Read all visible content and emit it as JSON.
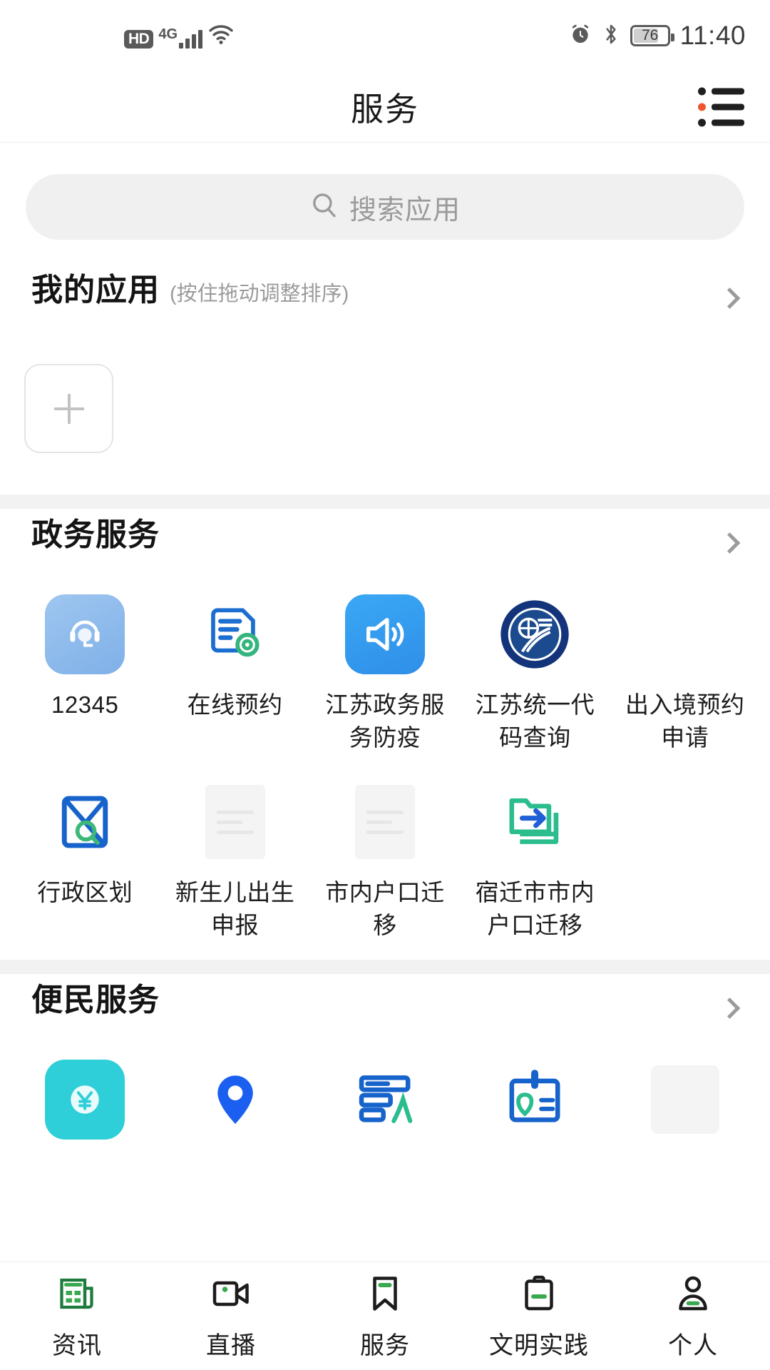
{
  "status_bar": {
    "hd_badge": "HD",
    "network": "4G",
    "battery_percent": "76",
    "time": "11:40",
    "icons": [
      "hd-icon",
      "signal-bars-icon",
      "wifi-icon",
      "alarm-clock-icon",
      "bluetooth-icon",
      "battery-icon"
    ]
  },
  "header": {
    "title": "服务",
    "menu_icon": "list-menu-icon"
  },
  "search": {
    "placeholder": "搜索应用",
    "icon": "search-icon"
  },
  "my_apps": {
    "title": "我的应用",
    "subtitle": "(按住拖动调整排序)",
    "add_tile_icon": "plus-icon",
    "chevron": "chevron-right-icon"
  },
  "sections": [
    {
      "title": "政务服务",
      "chevron": "chevron-right-icon",
      "apps": [
        {
          "label": "12345",
          "icon": "headset-support-icon",
          "style": "rounded-blue"
        },
        {
          "label": "在线预约",
          "icon": "document-gear-icon",
          "style": "line-art"
        },
        {
          "label": "江苏政务服务防疫",
          "icon": "speaker-announce-icon",
          "style": "rounded-blue-solid"
        },
        {
          "label": "江苏统一代码查询",
          "icon": "official-seal-icon",
          "style": "emblem"
        },
        {
          "label": "出入境预约申请",
          "icon": "scroll-stamp-icon",
          "style": "rounded-green"
        },
        {
          "label": "行政区划",
          "icon": "map-search-icon",
          "style": "line-art"
        },
        {
          "label": "新生儿出生申报",
          "icon": "loading-placeholder-icon",
          "style": "placeholder"
        },
        {
          "label": "市内户口迁移",
          "icon": "loading-placeholder-icon",
          "style": "placeholder"
        },
        {
          "label": "宿迁市市内户口迁移",
          "icon": "folder-transfer-icon",
          "style": "line-art"
        }
      ]
    },
    {
      "title": "便民服务",
      "chevron": "chevron-right-icon",
      "apps": [
        {
          "label": "",
          "icon": "yuan-coin-icon",
          "style": "rounded-cyan"
        },
        {
          "label": "",
          "icon": "map-pin-icon",
          "style": "line-art"
        },
        {
          "label": "",
          "icon": "form-document-icon",
          "style": "line-art"
        },
        {
          "label": "",
          "icon": "id-card-icon",
          "style": "line-art"
        },
        {
          "label": "",
          "icon": "loading-placeholder-icon",
          "style": "placeholder"
        }
      ]
    }
  ],
  "tabbar": {
    "items": [
      {
        "label": "资讯",
        "icon": "newspaper-icon"
      },
      {
        "label": "直播",
        "icon": "video-camera-icon"
      },
      {
        "label": "服务",
        "icon": "bookmark-icon"
      },
      {
        "label": "文明实践",
        "icon": "clipboard-icon"
      },
      {
        "label": "个人",
        "icon": "person-icon"
      }
    ]
  },
  "colors": {
    "accent_orange": "#f0562d",
    "blue": "#2f9bf0",
    "green": "#2fbf8f",
    "dark_blue": "#1b4a8f",
    "cyan": "#2ecfd8",
    "text": "#1a1a1a",
    "muted": "#9b9b9b"
  }
}
